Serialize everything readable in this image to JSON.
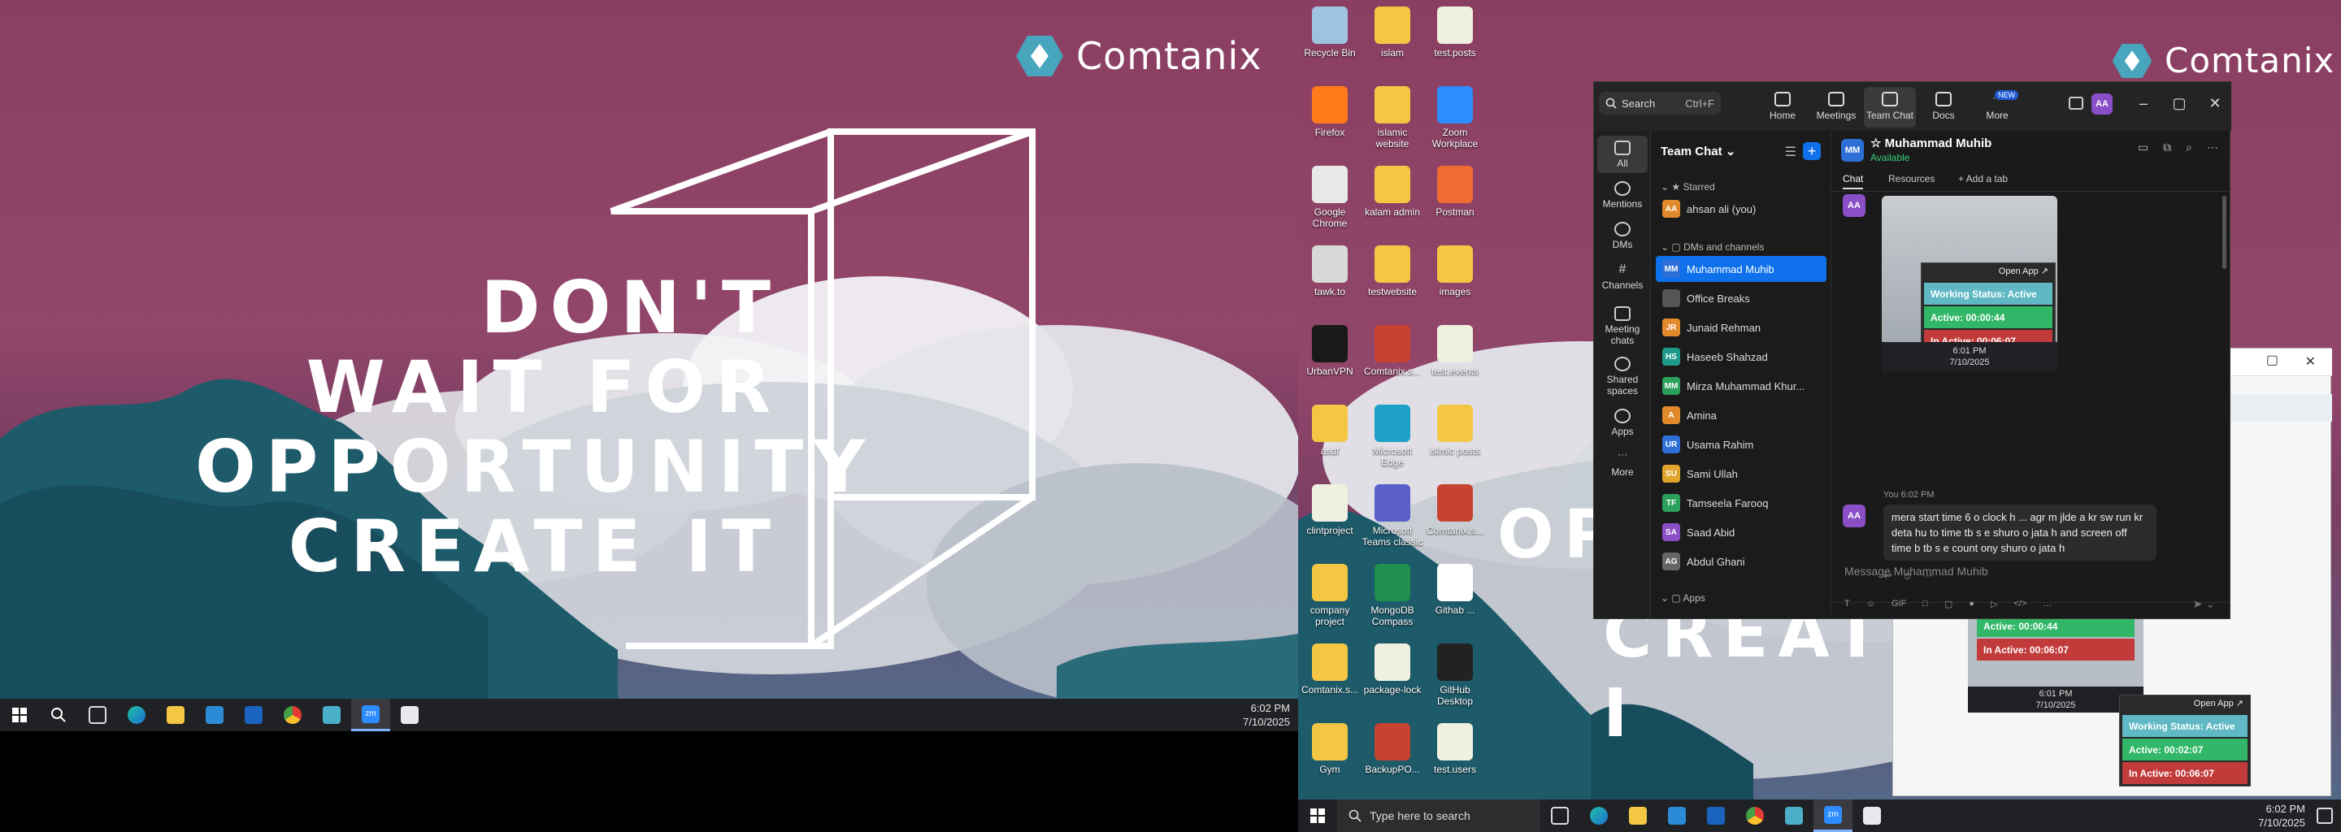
{
  "left_wallpaper": {
    "brand": "Comtanix",
    "slogan_lines": [
      "DON'T",
      "WAIT FOR",
      "OPPORTUNITY",
      "CREATE IT"
    ]
  },
  "left_taskbar": {
    "time": "6:02 PM",
    "date": "7/10/2025",
    "icons": [
      "windows-start-icon",
      "search-icon",
      "task-view-icon",
      "edge-icon",
      "file-explorer-icon",
      "store-icon",
      "outlook-icon",
      "chrome-icon",
      "app-icon",
      "zoom-icon",
      "snipping-icon"
    ]
  },
  "right_wallpaper": {
    "brand": "Comtanix",
    "slogan_partial_1": "OPP",
    "slogan_partial_2": "CREATE I"
  },
  "desktop_icons": [
    {
      "label": "Recycle Bin"
    },
    {
      "label": "islam"
    },
    {
      "label": "test.posts"
    },
    {
      "label": "Firefox"
    },
    {
      "label": "islamic website"
    },
    {
      "label": "Zoom Workplace"
    },
    {
      "label": "Google Chrome"
    },
    {
      "label": "kalam admin"
    },
    {
      "label": "Postman"
    },
    {
      "label": "tawk.to"
    },
    {
      "label": "testwebsite"
    },
    {
      "label": "images"
    },
    {
      "label": "UrbanVPN"
    },
    {
      "label": "Comtanix.s..."
    },
    {
      "label": "test.events"
    },
    {
      "label": "asdf"
    },
    {
      "label": "Microsoft Edge"
    },
    {
      "label": "islmic posts"
    },
    {
      "label": "clintproject"
    },
    {
      "label": "Microsoft Teams classic"
    },
    {
      "label": "Comtanix.s..."
    },
    {
      "label": "company project"
    },
    {
      "label": "MongoDB Compass"
    },
    {
      "label": "Githab ..."
    },
    {
      "label": "Comtanix.s..."
    },
    {
      "label": "package-lock"
    },
    {
      "label": "GitHub Desktop"
    },
    {
      "label": "Gym"
    },
    {
      "label": "BackupPO..."
    },
    {
      "label": "test.users"
    }
  ],
  "zoom": {
    "search_placeholder": "Search",
    "search_shortcut": "Ctrl+F",
    "nav": [
      {
        "label": "Home"
      },
      {
        "label": "Meetings"
      },
      {
        "label": "Team Chat"
      },
      {
        "label": "Docs"
      },
      {
        "label": "More"
      }
    ],
    "new_badge": "NEW",
    "user_initials": "AA",
    "rail": [
      {
        "label": "All"
      },
      {
        "label": "Mentions"
      },
      {
        "label": "DMs"
      },
      {
        "label": "Channels"
      },
      {
        "label": "Meeting chats"
      },
      {
        "label": "Shared spaces"
      },
      {
        "label": "Apps"
      },
      {
        "label": "More"
      }
    ],
    "chanlist": {
      "title": "Team Chat",
      "starred_label": "Starred",
      "starred": [
        {
          "name": "ahsan ali (you)",
          "initials": "AA",
          "color": "#e08a2b"
        }
      ],
      "dms_label": "DMs and channels",
      "dms": [
        {
          "name": "Muhammad Muhib",
          "initials": "MM",
          "color": "#2d6fd6"
        },
        {
          "name": "Office Breaks",
          "initials": "",
          "color": "#555555"
        },
        {
          "name": "Junaid Rehman",
          "initials": "JR",
          "color": "#e08a2b"
        },
        {
          "name": "Haseeb Shahzad",
          "initials": "HS",
          "color": "#1f9a8a"
        },
        {
          "name": "Mirza Muhammad Khur...",
          "initials": "MM",
          "color": "#2aa05a"
        },
        {
          "name": "Amina",
          "initials": "A",
          "color": "#e08a2b"
        },
        {
          "name": "Usama Rahim",
          "initials": "UR",
          "color": "#2d6fd6"
        },
        {
          "name": "Sami Ullah",
          "initials": "SU",
          "color": "#e0a32b"
        },
        {
          "name": "Tamseela Farooq",
          "initials": "TF",
          "color": "#2aa05a"
        },
        {
          "name": "Saad Abid",
          "initials": "SA",
          "color": "#8a4fc7"
        },
        {
          "name": "Abdul Ghani",
          "initials": "AG",
          "color": "#666666"
        }
      ],
      "apps_label": "Apps"
    },
    "chat": {
      "contact_initials": "MM",
      "contact_name": "Muhammad Muhib",
      "contact_status": "Available",
      "tabs": [
        "Chat",
        "Resources",
        "+ Add a tab"
      ],
      "ws_open_app": "Open App ↗",
      "ws_status": "Working Status: Active",
      "ws_active": "Active: 00:00:44",
      "ws_inactive": "In Active: 00:06:07",
      "shot_time": "6:01 PM",
      "shot_date": "7/10/2025",
      "msg_sender_initials": "AA",
      "msg_meta": "You 6:02 PM",
      "msg_text": "mera start time 6 o clock h ... agr m jlde  a kr sw run kr deta hu to time tb s e shuro o jata h and screen off time b tb s e count ony shuro o jata h",
      "composer_placeholder": "Message Muhammad Muhib",
      "composer_tools": [
        "T",
        "☺",
        "GIF",
        "□",
        "▢",
        "●",
        "▷",
        "</>",
        "…"
      ]
    }
  },
  "second_window": {
    "ws_open_app": "Open App ↗",
    "ws_status": "Working Status: Active",
    "ws_active": "Active: 00:02:07",
    "ws_inactive": "In Active: 00:06:07",
    "inner_active": "Active: 00:00:44",
    "inner_inactive": "In Active: 00:06:07",
    "inner_time": "6:01 PM",
    "inner_date": "7/10/2025"
  },
  "right_taskbar": {
    "search_placeholder": "Type here to search",
    "time": "6:02 PM",
    "date": "7/10/2025"
  }
}
